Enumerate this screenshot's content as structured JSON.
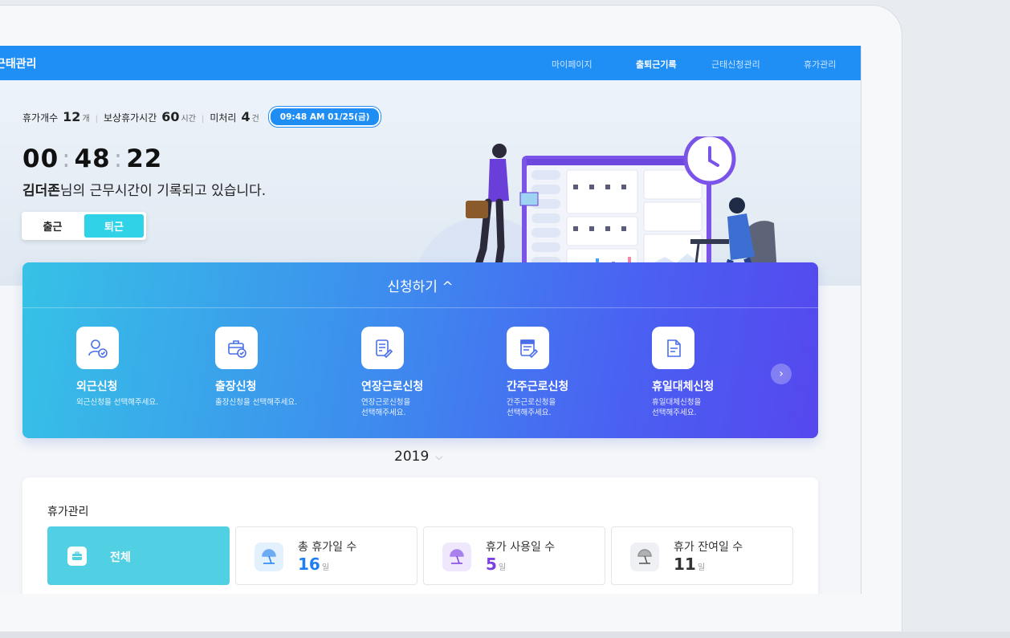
{
  "nav": {
    "brand": "근태관리",
    "items": [
      "마이페이지",
      "출퇴근기록",
      "근태신청관리",
      "휴가관리"
    ],
    "active": "출퇴근기록"
  },
  "status": {
    "leave_count_label": "휴가개수",
    "leave_count": "12",
    "leave_count_unit": "개",
    "comp_label": "보상휴가시간",
    "comp_hours": "60",
    "comp_unit": "시간",
    "pending_label": "미처리",
    "pending": "4",
    "pending_unit": "건",
    "datetime": "09:48 AM  01/25(금)"
  },
  "timer": {
    "hh": "00",
    "mm": "48",
    "ss": "22"
  },
  "recording": {
    "name": "김더존",
    "text": "님의 근무시간이 기록되고 있습니다."
  },
  "toggle": {
    "in": "출근",
    "out": "퇴근"
  },
  "apply": {
    "title": "신청하기 ^",
    "items": [
      {
        "name": "외근신청",
        "desc": "외근신청을 선택해주세요."
      },
      {
        "name": "출장신청",
        "desc": "출장신청을 선택해주세요."
      },
      {
        "name": "연장근로신청",
        "desc": "연장근로신청을\n선택해주세요."
      },
      {
        "name": "간주근로신청",
        "desc": "간주근로신청을\n선택해주세요."
      },
      {
        "name": "휴일대체신청",
        "desc": "휴일대체신청을\n선택해주세요."
      }
    ]
  },
  "year": "2019",
  "leave": {
    "title": "휴가관리",
    "all": "전체",
    "stats": [
      {
        "label": "총 휴가일 수",
        "value": "16",
        "unit": "일",
        "color": "#1e7ff0"
      },
      {
        "label": "휴가 사용일 수",
        "value": "5",
        "unit": "일",
        "color": "#7b3fe4"
      },
      {
        "label": "휴가 잔여일 수",
        "value": "11",
        "unit": "일",
        "color": "#333333"
      }
    ]
  },
  "colors": {
    "nav": "#1f8ef5",
    "accent_cyan": "#30d2e7",
    "card_start": "#36c2e6",
    "card_end": "#5547ee"
  }
}
